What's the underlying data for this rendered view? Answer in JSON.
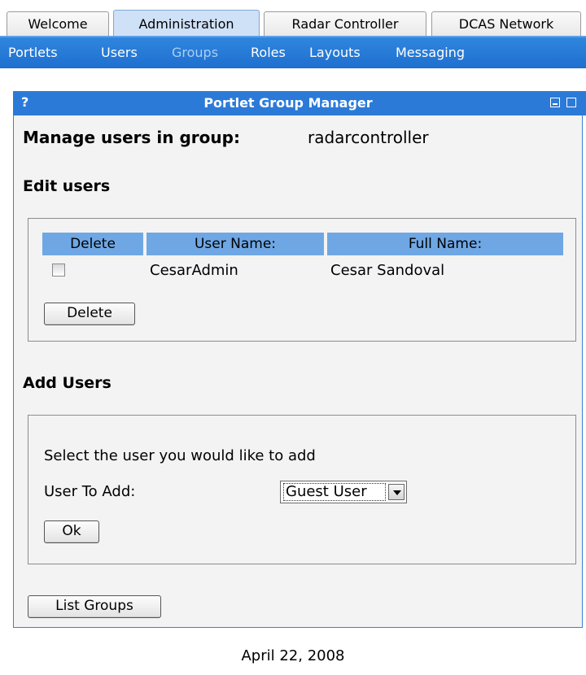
{
  "tabs": [
    {
      "label": "Welcome"
    },
    {
      "label": "Administration"
    },
    {
      "label": "Radar Controller"
    },
    {
      "label": "DCAS Network"
    }
  ],
  "subnav": {
    "items": [
      {
        "label": "Portlets"
      },
      {
        "label": "Users"
      },
      {
        "label": "Groups"
      },
      {
        "label": "Roles"
      },
      {
        "label": "Layouts"
      },
      {
        "label": "Messaging"
      }
    ],
    "current": "Groups"
  },
  "portlet": {
    "help": "?",
    "title": "Portlet Group Manager"
  },
  "manage": {
    "label": "Manage users in group:",
    "group": "radarcontroller"
  },
  "edit_users": {
    "heading": "Edit users",
    "columns": [
      "Delete",
      "User Name:",
      "Full Name:"
    ],
    "rows": [
      {
        "user_name": "CesarAdmin",
        "full_name": "Cesar Sandoval",
        "checked": false
      }
    ],
    "delete_button": "Delete"
  },
  "add_users": {
    "heading": "Add Users",
    "instruction": "Select the user you would like to add",
    "field_label": "User To Add:",
    "selected_user": "Guest User",
    "ok_button": "Ok"
  },
  "list_groups_button": "List Groups",
  "footer_date": "April 22, 2008",
  "colors": {
    "accent": "#2b7ad8",
    "active_tab": "#cfe1f7",
    "table_header": "#6fa7e4",
    "panel_bg": "#f3f3f3"
  }
}
